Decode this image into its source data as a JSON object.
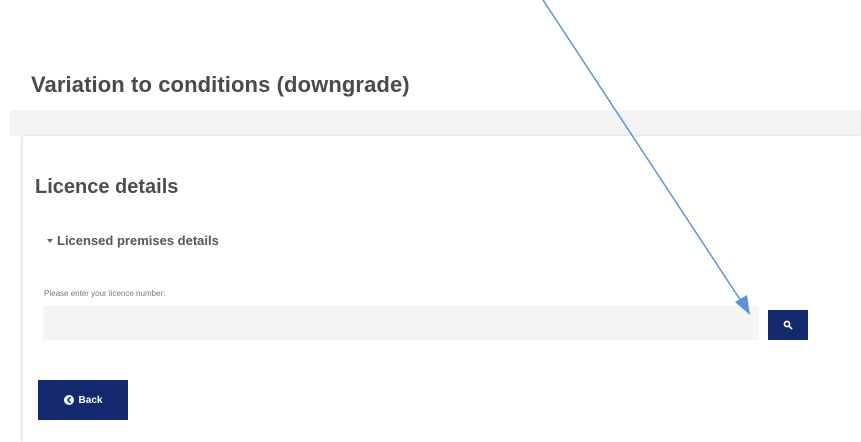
{
  "page": {
    "title": "Variation to conditions (downgrade)"
  },
  "section": {
    "title": "Licence details",
    "accordion_label": "Licensed premises details"
  },
  "licence_field": {
    "label": "Please enter your licence number:",
    "value": "",
    "placeholder": ""
  },
  "buttons": {
    "search_icon": "magnifier-icon",
    "back_label": "Back",
    "back_icon": "circle-arrow-left-icon"
  },
  "colors": {
    "button_bg": "#14286e",
    "arrow": "#5a93d6"
  }
}
